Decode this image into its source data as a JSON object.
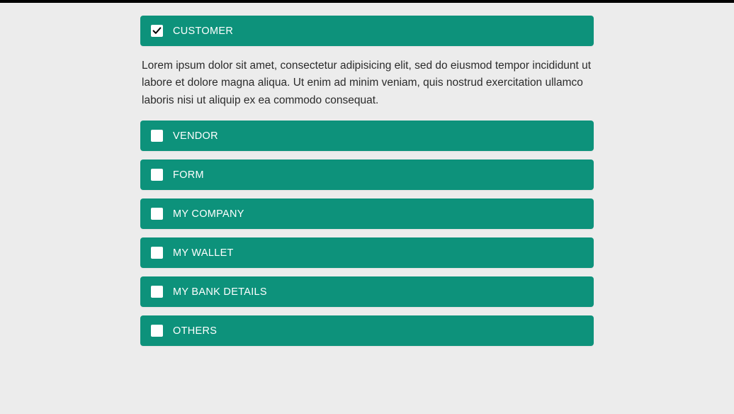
{
  "items": [
    {
      "label": "CUSTOMER",
      "checked": true,
      "expanded": true,
      "body": "Lorem ipsum dolor sit amet, consectetur adipisicing elit, sed do eiusmod tempor incididunt ut labore et dolore magna aliqua. Ut enim ad minim veniam, quis nostrud exercitation ullamco laboris nisi ut aliquip ex ea commodo consequat."
    },
    {
      "label": "VENDOR",
      "checked": false,
      "expanded": false,
      "body": ""
    },
    {
      "label": "FORM",
      "checked": false,
      "expanded": false,
      "body": ""
    },
    {
      "label": "MY COMPANY",
      "checked": false,
      "expanded": false,
      "body": ""
    },
    {
      "label": "MY WALLET",
      "checked": false,
      "expanded": false,
      "body": ""
    },
    {
      "label": "MY BANK DETAILS",
      "checked": false,
      "expanded": false,
      "body": ""
    },
    {
      "label": "OTHERS",
      "checked": false,
      "expanded": false,
      "body": ""
    }
  ],
  "colors": {
    "accent": "#0d927b",
    "background": "#ececec"
  }
}
